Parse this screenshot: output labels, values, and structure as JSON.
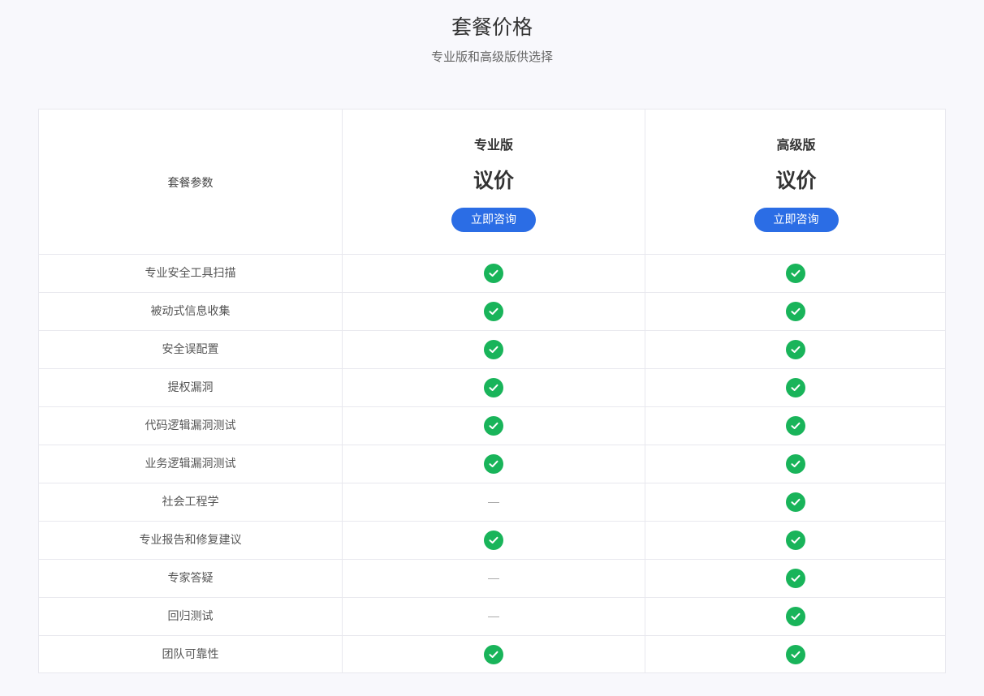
{
  "header": {
    "title": "套餐价格",
    "subtitle": "专业版和高级版供选择"
  },
  "table": {
    "param_header": "套餐参数",
    "plans": [
      {
        "name": "专业版",
        "price": "议价",
        "button": "立即咨询"
      },
      {
        "name": "高级版",
        "price": "议价",
        "button": "立即咨询"
      }
    ],
    "features": [
      {
        "label": "专业安全工具扫描",
        "pro": true,
        "adv": true
      },
      {
        "label": "被动式信息收集",
        "pro": true,
        "adv": true
      },
      {
        "label": "安全误配置",
        "pro": true,
        "adv": true
      },
      {
        "label": "提权漏洞",
        "pro": true,
        "adv": true
      },
      {
        "label": "代码逻辑漏洞测试",
        "pro": true,
        "adv": true
      },
      {
        "label": "业务逻辑漏洞测试",
        "pro": true,
        "adv": true
      },
      {
        "label": "社会工程学",
        "pro": false,
        "adv": true
      },
      {
        "label": "专业报告和修复建议",
        "pro": true,
        "adv": true
      },
      {
        "label": "专家答疑",
        "pro": false,
        "adv": true
      },
      {
        "label": "回归测试",
        "pro": false,
        "adv": true
      },
      {
        "label": "团队可靠性",
        "pro": true,
        "adv": true
      }
    ]
  },
  "icons": {
    "included": "check-circle-icon",
    "not_included": "dash-icon"
  },
  "colors": {
    "accent": "#2b6de5",
    "check": "#19b45a",
    "background": "#f8f8fc"
  }
}
